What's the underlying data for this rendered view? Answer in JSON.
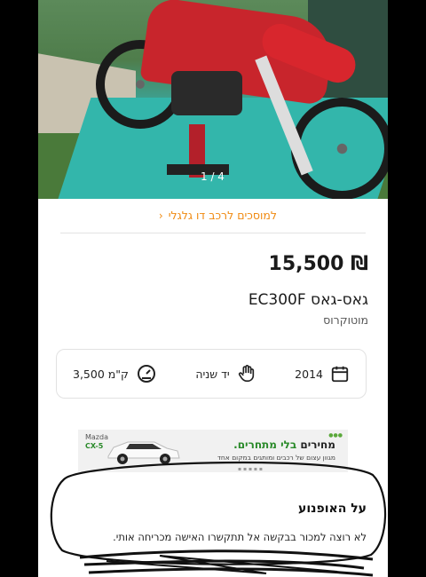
{
  "gallery": {
    "counter": "1 / 4"
  },
  "breadcrumb": {
    "label": "למוסכים לרכב דו גלגלי"
  },
  "listing": {
    "price": "₪ 15,500",
    "title": "גאס-גאס EC300F",
    "category": "מוטוקרוס"
  },
  "specs": {
    "year": {
      "value": "2014",
      "icon": "calendar-icon"
    },
    "hand": {
      "value": "יד שניה",
      "icon": "hand-icon"
    },
    "mileage": {
      "value": "3,500 ק\"מ",
      "icon": "speedometer-icon"
    }
  },
  "ad": {
    "brand": "Mazda",
    "model": "CX-5",
    "headline_regular": "מחירים ",
    "headline_highlight": "בלי מתחרים.",
    "tagline": "מגוון עצום של רכבים ומותגים במקום אחד"
  },
  "about": {
    "title": "על האופנוע",
    "text": "לא רוצה למכור בבקשה אל תתקשרו האישה מכריחה אותי."
  },
  "colors": {
    "accent": "#f08a11",
    "background": "#ffffff",
    "frame": "#000000"
  }
}
